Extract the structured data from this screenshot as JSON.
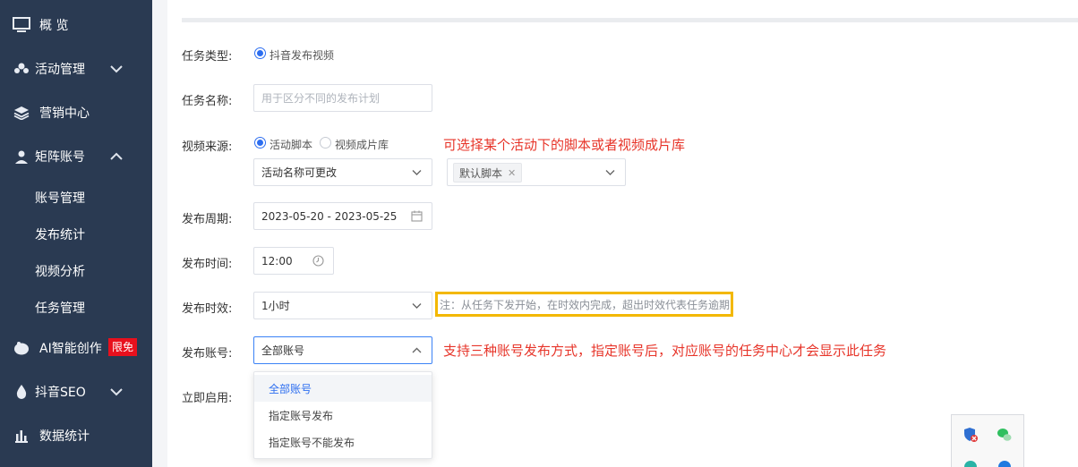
{
  "sidebar": {
    "items": [
      {
        "label": "概 览",
        "icon": "monitor-icon"
      },
      {
        "label": "活动管理",
        "icon": "group-icon",
        "expanded": false
      },
      {
        "label": "营销中心",
        "icon": "layers-icon"
      },
      {
        "label": "矩阵账号",
        "icon": "user-icon",
        "expanded": true
      },
      {
        "label": "AI智能创作",
        "icon": "chat-bubble-icon",
        "badge": "限免"
      },
      {
        "label": "抖音SEO",
        "icon": "drop-icon",
        "expanded": false
      },
      {
        "label": "数据统计",
        "icon": "bar-chart-icon"
      }
    ],
    "subitems": [
      "账号管理",
      "发布统计",
      "视频分析",
      "任务管理"
    ]
  },
  "form": {
    "task_type": {
      "label": "任务类型:",
      "option": "抖音发布视频"
    },
    "task_name": {
      "label": "任务名称:",
      "placeholder": "用于区分不同的发布计划"
    },
    "video_source": {
      "label": "视频来源:",
      "options": [
        "活动脚本",
        "视频成片库"
      ],
      "selected": "活动脚本",
      "activity_select": "活动名称可更改",
      "script_tag": "默认脚本"
    },
    "period": {
      "label": "发布周期:",
      "value": "2023-05-20 - 2023-05-25"
    },
    "time": {
      "label": "发布时间:",
      "value": "12:00"
    },
    "validity": {
      "label": "发布时效:",
      "value": "1小时"
    },
    "account": {
      "label": "发布账号:",
      "value": "全部账号",
      "options": [
        "全部账号",
        "指定账号发布",
        "指定账号不能发布"
      ]
    },
    "enable_now": {
      "label": "立即启用:"
    }
  },
  "notes": {
    "source_note": "可选择某个活动下的脚本或者视频成片库",
    "validity_note": "注：从任务下发开始，在时效内完成，超出时效代表任务逾期",
    "account_note": "支持三种账号发布方式，指定账号后，对应账号的任务中心才会显示此任务"
  },
  "colors": {
    "sidebar_bg": "#2a3a52",
    "accent": "#2d6ef0",
    "note_red": "#e7352a",
    "note_border": "#f3b800",
    "badge_red": "#e8101d"
  }
}
